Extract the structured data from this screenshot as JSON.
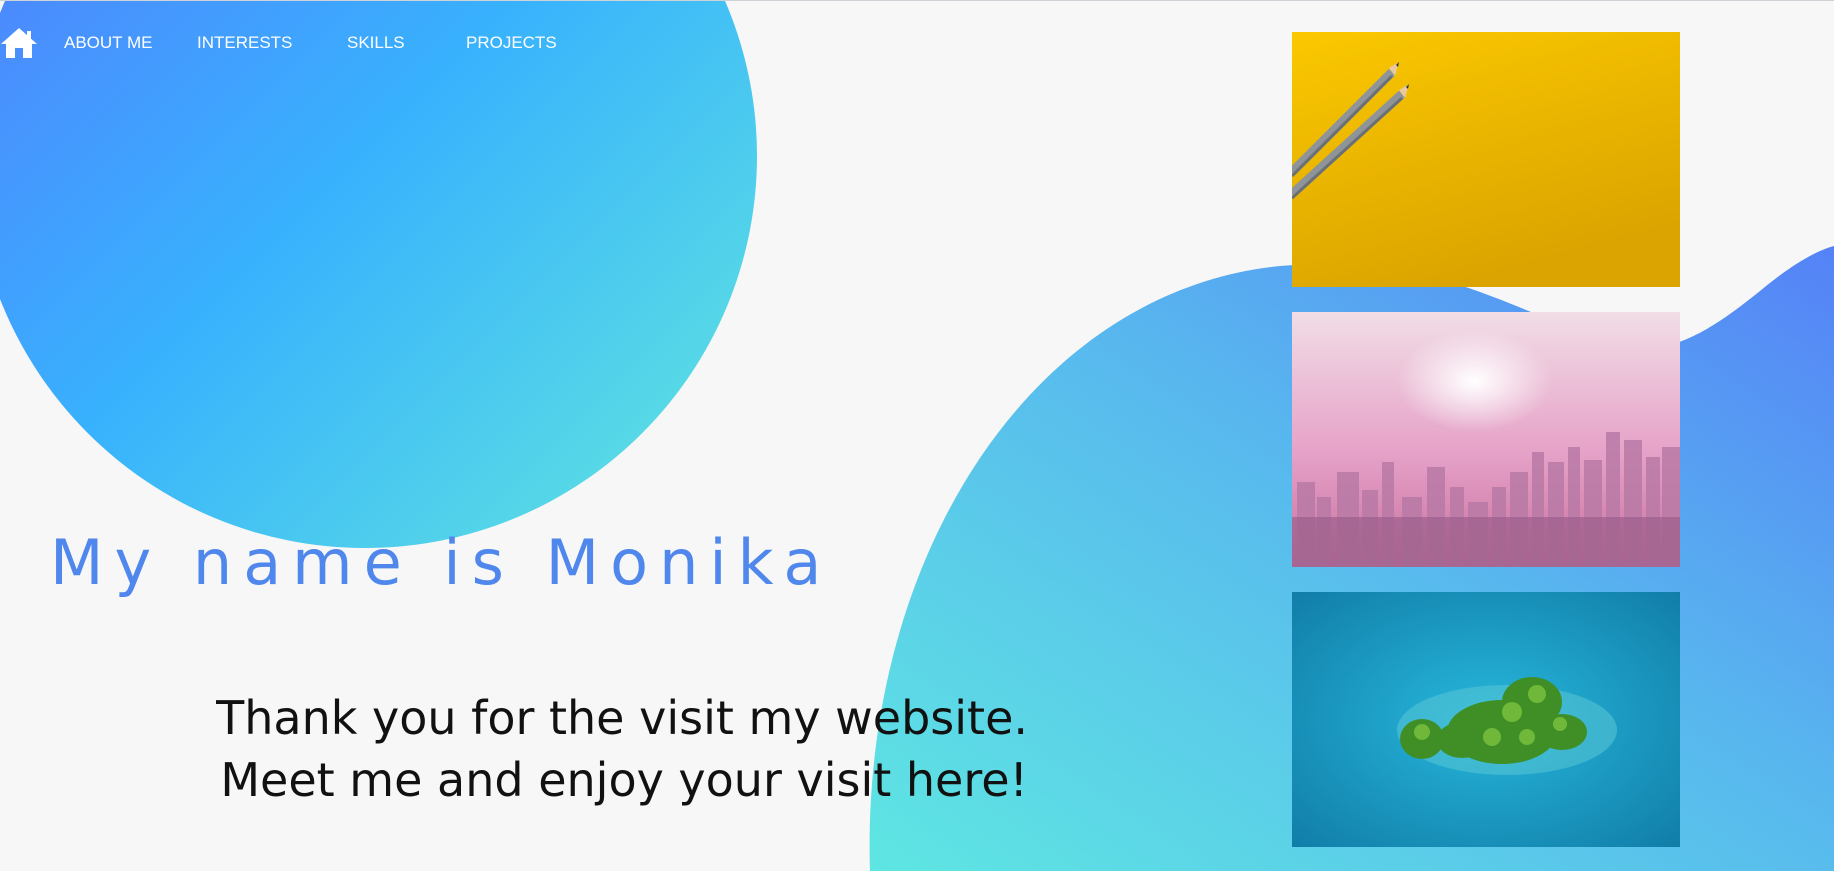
{
  "nav": {
    "home_icon": "home-icon",
    "links": [
      {
        "label": "ABOUT ME"
      },
      {
        "label": "INTERESTS"
      },
      {
        "label": "SKILLS"
      },
      {
        "label": "PROJECTS"
      }
    ]
  },
  "hero": {
    "title": "My name is Monika",
    "text": "Thank you for the visit my website. Meet me and enjoy your visit here!"
  },
  "gallery": [
    {
      "subject": "pencils on yellow background"
    },
    {
      "subject": "pink misty city skyline"
    },
    {
      "subject": "aerial view of green island in blue sea"
    }
  ],
  "colors": {
    "background": "#f7f7f7",
    "gradient_blue": "#4a7dff",
    "gradient_cyan": "#5ee4e2",
    "title": "#4f87ec",
    "text": "#111111"
  }
}
